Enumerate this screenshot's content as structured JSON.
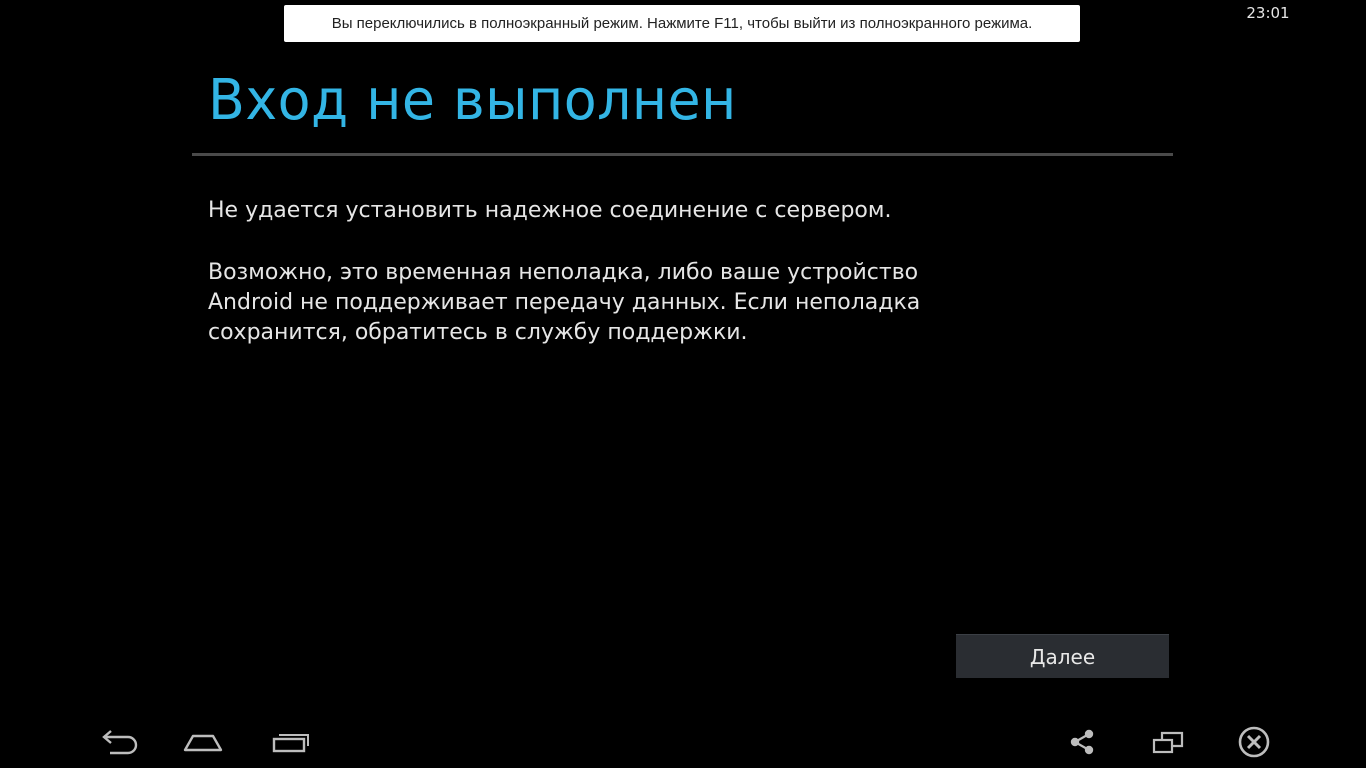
{
  "browser": {
    "fullscreen_notice": "Вы переключились в полноэкранный режим. Нажмите F11, чтобы выйти из полноэкранного режима."
  },
  "status_bar": {
    "time": "23:01"
  },
  "dialog": {
    "title": "Вход не выполнен",
    "message_1": "Не удается установить надежное соединение с сервером.",
    "message_2": "Возможно, это временная неполадка, либо ваше устройство Android не поддерживает передачу данных. Если неполадка сохранится, обратитесь в службу поддержки.",
    "next_label": "Далее"
  },
  "colors": {
    "accent": "#33b5e5",
    "background": "#000000",
    "button": "#2a2d32"
  },
  "nav_bar": {
    "icons": [
      "back-icon",
      "home-icon",
      "recent-apps-icon",
      "share-icon",
      "window-icon",
      "close-icon"
    ]
  }
}
